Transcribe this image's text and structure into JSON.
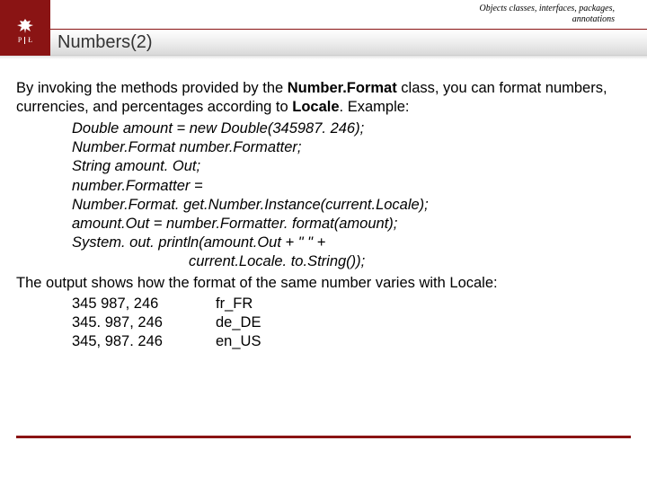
{
  "header": {
    "logo_left": "P",
    "logo_right": "Ł",
    "breadcrumb_line1": "Objects classes, interfaces, packages,",
    "breadcrumb_line2": "annotations",
    "title": "Numbers(2)"
  },
  "body": {
    "intro_pre": "By invoking the methods provided by the ",
    "intro_bold1": "Number.Format",
    "intro_mid": " class, you can format numbers, currencies, and percentages according to ",
    "intro_bold2": "Locale",
    "intro_post": ". Example:",
    "code": {
      "l1": "Double amount = new Double(345987. 246);",
      "l2": "Number.Format number.Formatter;",
      "l3": "String amount. Out;",
      "l4": "number.Formatter =",
      "l5": "Number.Format. get.Number.Instance(current.Locale);",
      "l6": "amount.Out = number.Formatter. format(amount);",
      "l7": "System. out. println(amount.Out + \" \" +",
      "l8": "current.Locale. to.String());"
    },
    "outro": "The output  shows how the format of the same number varies with Locale:",
    "output": [
      {
        "num": "345 987, 246",
        "loc": "fr_FR"
      },
      {
        "num": "345. 987, 246",
        "loc": "de_DE"
      },
      {
        "num": "345, 987. 246",
        "loc": "en_US"
      }
    ]
  },
  "colors": {
    "brand": "#8a1414"
  }
}
